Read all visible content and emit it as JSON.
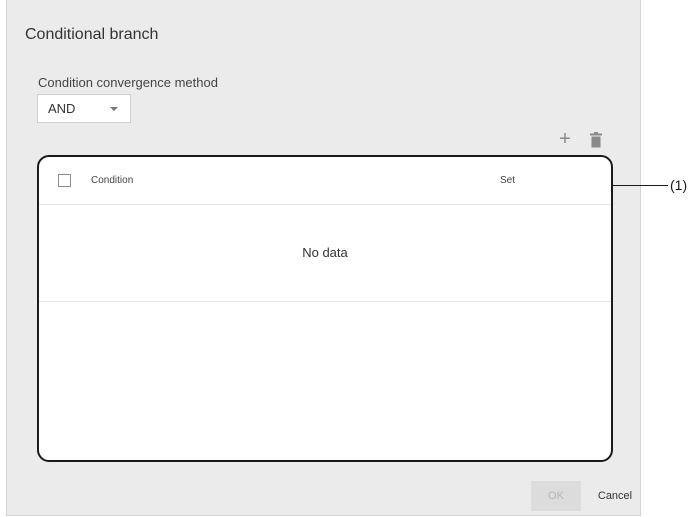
{
  "dialog": {
    "title": "Conditional branch",
    "convergence": {
      "label": "Condition convergence method",
      "selected": "AND"
    },
    "toolbar": {
      "add": "+"
    },
    "table": {
      "columns": [
        "Condition",
        "Set"
      ],
      "empty_text": "No data"
    },
    "buttons": {
      "ok": "OK",
      "cancel": "Cancel"
    }
  },
  "annotation": {
    "callout": "(1)"
  }
}
